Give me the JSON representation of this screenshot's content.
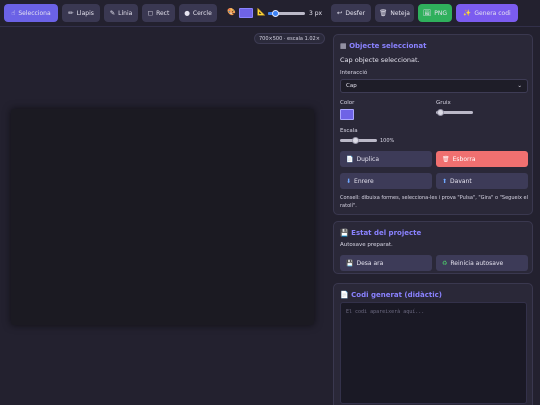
{
  "toolbar": {
    "select_label": "Selecciona",
    "pencil_label": "Llapis",
    "line_label": "Línia",
    "rect_label": "Rect",
    "circle_label": "Cercle",
    "thickness_value": "3 px",
    "undo_label": "Desfer",
    "clear_label": "Neteja",
    "png_label": "PNG",
    "generate_label": "Genera codi",
    "color_hex": "#6e63e6",
    "thickness_fraction": 0.2
  },
  "canvas": {
    "scale_badge": "700×500 · escala 1.02×",
    "background": "#1b1a22"
  },
  "selected_panel": {
    "title": "Objecte seleccionat",
    "status": "Cap objecte seleccionat.",
    "interaction_label": "Interacció",
    "interaction_value": "Cap",
    "color_label": "Color",
    "thickness_label": "Gruix",
    "scale_label": "Escala",
    "scale_value": "100%",
    "duplicate_label": "Duplica",
    "delete_label": "Esborra",
    "back_label": "Enrere",
    "front_label": "Davant",
    "tip": "Consell: dibuixa formes, selecciona-les i prova \"Pulsa\", \"Gira\" o \"Segueix el ratolí\".",
    "color_hex": "#6e63e6"
  },
  "project_panel": {
    "title": "Estat del projecte",
    "status": "Autosave preparat.",
    "save_label": "Desa ara",
    "reset_label": "Reinicia autosave"
  },
  "code_panel": {
    "title": "Codi generat (didàctic)",
    "placeholder": "El codi apareixerà aquí..."
  },
  "colors": {
    "accent": "#6b62e6",
    "danger": "#f07070",
    "success": "#2fb05c",
    "panel_bg": "#2a2838"
  }
}
